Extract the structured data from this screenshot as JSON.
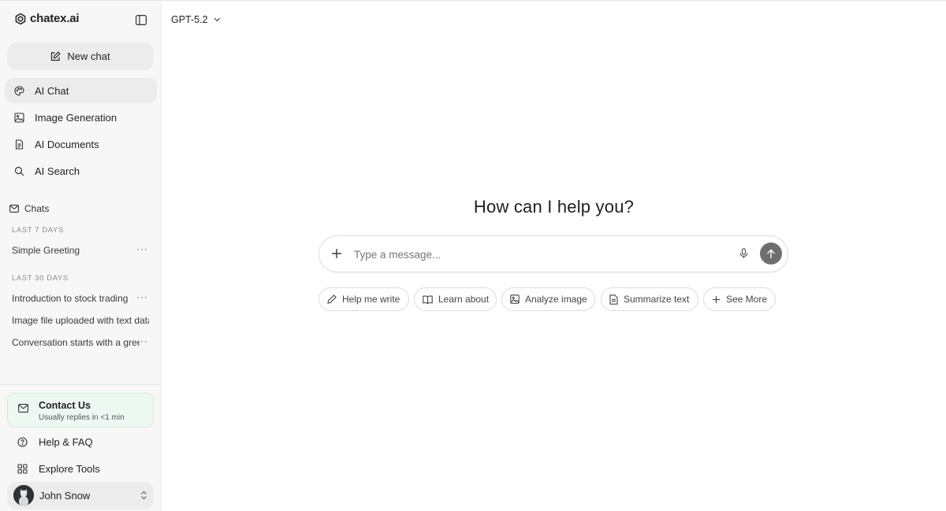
{
  "brand": {
    "name": "chatex.ai"
  },
  "sidebar": {
    "new_chat_label": "New chat",
    "nav": [
      {
        "label": "AI Chat",
        "icon": "palette-icon",
        "active": true
      },
      {
        "label": "Image Generation",
        "icon": "image-icon"
      },
      {
        "label": "AI Documents",
        "icon": "document-icon"
      },
      {
        "label": "AI Search",
        "icon": "search-icon"
      }
    ],
    "chats_label": "Chats",
    "sections": [
      {
        "label": "LAST 7 DAYS",
        "items": [
          {
            "title": "Simple Greeting"
          }
        ]
      },
      {
        "label": "LAST 30 DAYS",
        "items": [
          {
            "title": "Introduction to stock trading"
          },
          {
            "title": "Image file uploaded with text data"
          },
          {
            "title": "Conversation starts with a greeting"
          }
        ]
      }
    ],
    "more_glyph": "···",
    "contact": {
      "title": "Contact Us",
      "subtitle": "Usually replies in <1 min"
    },
    "help_label": "Help & FAQ",
    "explore_label": "Explore Tools",
    "user": {
      "name": "John Snow"
    }
  },
  "main": {
    "model": "GPT-5.2",
    "heading": "How can I help you?",
    "composer": {
      "placeholder": "Type a message...",
      "value": ""
    },
    "suggestions": [
      {
        "label": "Help me write",
        "icon": "pencil-icon"
      },
      {
        "label": "Learn about",
        "icon": "book-icon"
      },
      {
        "label": "Analyze image",
        "icon": "image-icon"
      },
      {
        "label": "Summarize text",
        "icon": "document-icon"
      },
      {
        "label": "See More",
        "icon": "plus-icon"
      }
    ]
  },
  "colors": {
    "sidebar_bg": "#f7f7f7",
    "active_item_bg": "#ececec",
    "contact_bg": "#eef8f3",
    "contact_border": "#cfeadc",
    "send_button": "#6e6e6e"
  }
}
